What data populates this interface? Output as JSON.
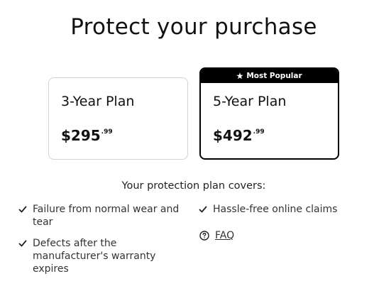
{
  "page": {
    "title": "Protect your purchase"
  },
  "plans": [
    {
      "name": "3-Year Plan",
      "price_whole": "$295",
      "price_cents": ".99"
    },
    {
      "name": "5-Year Plan",
      "price_whole": "$492",
      "price_cents": ".99",
      "badge": "Most Popular"
    }
  ],
  "coverage": {
    "title": "Your protection plan covers:",
    "items": [
      "Failure from normal wear and tear",
      "Defects after the manufacturer's warranty expires",
      "Hassle-free online claims"
    ],
    "faq_label": "FAQ"
  },
  "icons": {
    "badge": "star-icon",
    "feature": "check-icon",
    "faq": "question-circle-icon"
  },
  "colors": {
    "selected_border": "#000000",
    "default_border": "#d2d2d2",
    "badge_bg": "#000000"
  }
}
